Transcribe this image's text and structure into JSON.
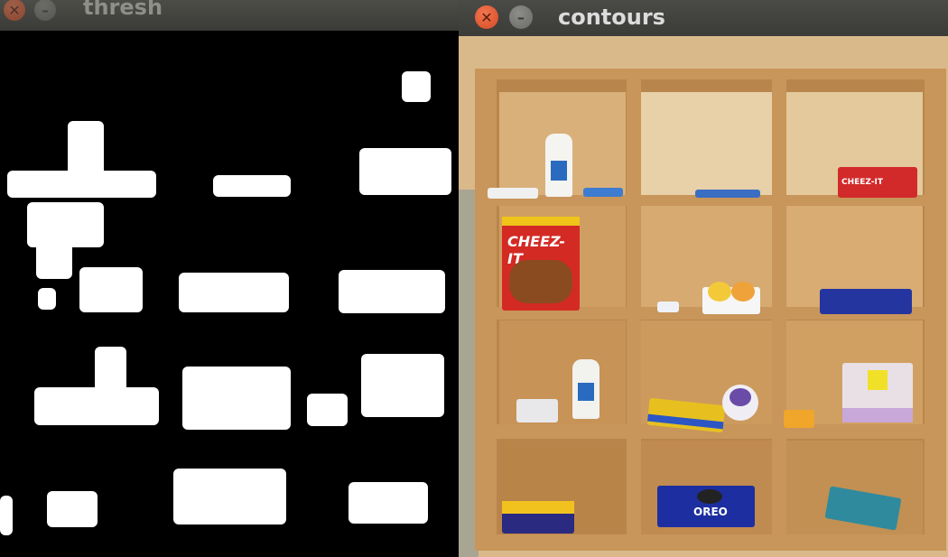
{
  "windows": {
    "thresh": {
      "title": "thresh"
    },
    "contours": {
      "title": "contours"
    }
  },
  "titlebar": {
    "close_glyph": "✕",
    "minimize_glyph": "–"
  },
  "colors": {
    "close_button": "#e05a33",
    "minimize_button": "#7a7a77",
    "titlebar": "#3b3b38",
    "threshold_bg": "#000000",
    "threshold_fg": "#ffffff",
    "shelf_wood": "#c8955a"
  },
  "products": {
    "cheezit": "CHEEZ-IT",
    "oreo": "OREO",
    "cheezit_small": "CHEEZ-IT"
  }
}
